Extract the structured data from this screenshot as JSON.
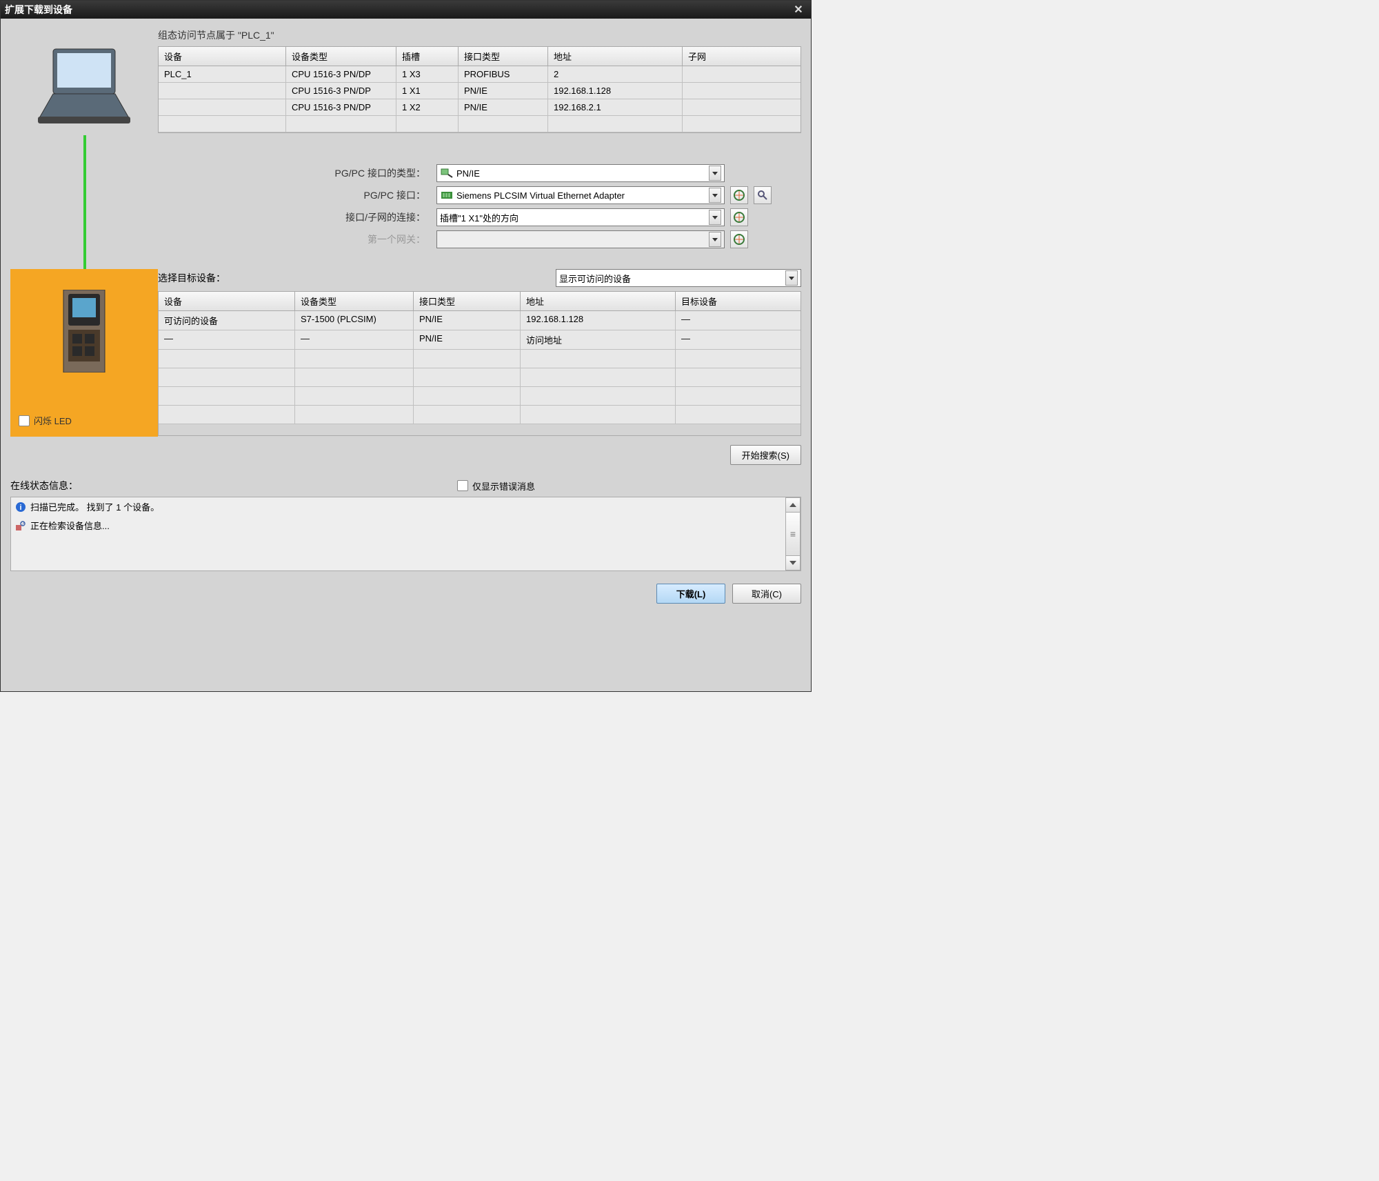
{
  "titlebar": {
    "title": "扩展下载到设备"
  },
  "nodes_caption": "组态访问节点属于 \"PLC_1\"",
  "nodes_headers": {
    "device": "设备",
    "devtype": "设备类型",
    "slot": "插槽",
    "iftype": "接口类型",
    "address": "地址",
    "subnet": "子网"
  },
  "nodes_rows": [
    {
      "device": "PLC_1",
      "devtype": "CPU 1516-3 PN/DP",
      "slot": "1 X3",
      "iftype": "PROFIBUS",
      "address": "2",
      "subnet": ""
    },
    {
      "device": "",
      "devtype": "CPU 1516-3 PN/DP",
      "slot": "1 X1",
      "iftype": "PN/IE",
      "address": "192.168.1.128",
      "subnet": ""
    },
    {
      "device": "",
      "devtype": "CPU 1516-3 PN/DP",
      "slot": "1 X2",
      "iftype": "PN/IE",
      "address": "192.168.2.1",
      "subnet": ""
    }
  ],
  "form": {
    "if_type_label": "PG/PC 接口的类型：",
    "if_type_value": "PN/IE",
    "if_label": "PG/PC 接口：",
    "if_value": "Siemens PLCSIM Virtual Ethernet Adapter",
    "subnet_label": "接口/子网的连接：",
    "subnet_value": "插槽\"1 X1\"处的方向",
    "gateway_label": "第一个网关：",
    "gateway_value": ""
  },
  "target": {
    "select_label": "选择目标设备：",
    "show_value": "显示可访问的设备",
    "headers": {
      "device": "设备",
      "devtype": "设备类型",
      "iftype": "接口类型",
      "address": "地址",
      "target": "目标设备"
    },
    "rows": [
      {
        "device": "可访问的设备",
        "devtype": "S7-1500 (PLCSIM)",
        "iftype": "PN/IE",
        "address": "192.168.1.128",
        "target": "—"
      },
      {
        "device": "—",
        "devtype": "—",
        "iftype": "PN/IE",
        "address": "访问地址",
        "target": "—"
      }
    ]
  },
  "led_label": "闪烁 LED",
  "start_search": "开始搜索(S)",
  "status": {
    "label": "在线状态信息：",
    "error_only": "仅显示错误消息",
    "lines": [
      "扫描已完成。 找到了 1 个设备。",
      "正在检索设备信息..."
    ]
  },
  "buttons": {
    "download": "下载(L)",
    "cancel": "取消(C)"
  }
}
